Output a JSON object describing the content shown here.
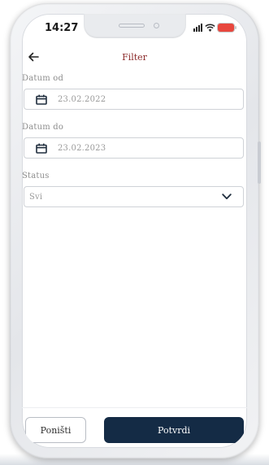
{
  "status_bar": {
    "time": "14:27"
  },
  "header": {
    "title": "Filter"
  },
  "filters": {
    "date_from": {
      "label": "Datum od",
      "value": "23.02.2022"
    },
    "date_to": {
      "label": "Datum do",
      "value": "23.02.2023"
    },
    "status": {
      "label": "Status",
      "selected": "Svi"
    }
  },
  "footer": {
    "reset_label": "Poništi",
    "confirm_label": "Potvrdi"
  },
  "colors": {
    "title_accent": "#8b2a2a",
    "primary_button": "#142b45",
    "battery": "#e8473e"
  },
  "icons": {
    "back": "arrow-left-icon",
    "calendar": "calendar-icon",
    "dropdown": "chevron-down-icon",
    "signal": "cellular-signal-icon",
    "wifi": "wifi-icon",
    "battery": "battery-icon"
  }
}
